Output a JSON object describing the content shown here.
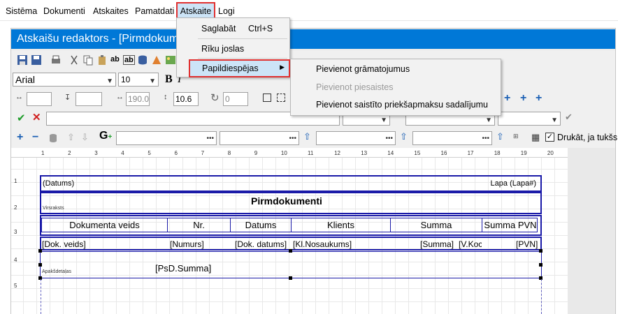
{
  "menubar": {
    "items": [
      "Sistēma",
      "Dokumenti",
      "Atskaites",
      "Pamatdati",
      "Atskaite",
      "Logi"
    ]
  },
  "window": {
    "title": "Atskaišu redaktors - [Pirmdokum"
  },
  "menu": {
    "items": [
      {
        "label": "Saglabāt",
        "shortcut": "Ctrl+S"
      },
      {
        "label": "Rīku joslas",
        "shortcut": ""
      },
      {
        "label": "Papildiespējas",
        "shortcut": ""
      }
    ]
  },
  "submenu": {
    "items": [
      {
        "label": "Pievienot grāmatojumus",
        "enabled": true
      },
      {
        "label": "Pievienot piesaistes",
        "enabled": false
      },
      {
        "label": "Pievienot saistīto priekšapmaksu sadalījumu",
        "enabled": true
      }
    ]
  },
  "toolbar": {
    "font_name": "Arial",
    "font_size": "10",
    "left_val": "190.0",
    "height_val": "10.6",
    "rotate_val": "0",
    "print_checkbox_label": "Drukāt, ja tukšs"
  },
  "ruler": {
    "ticks": [
      "1",
      "2",
      "3",
      "4",
      "5",
      "6",
      "7",
      "8",
      "9",
      "10",
      "11",
      "12",
      "13",
      "14",
      "15",
      "16",
      "17",
      "18",
      "19",
      "20"
    ],
    "rows": [
      "1",
      "2",
      "3",
      "4",
      "5"
    ]
  },
  "report": {
    "page_header": {
      "left": "(Datums)",
      "right": "Lapa (Lapa#)"
    },
    "title": "Pirmdokumenti",
    "virsraksts_label": "Virsraksts",
    "columns": [
      "Dokumenta veids",
      "Nr.",
      "Datums",
      "Klients",
      "Summa",
      "Summa PVN"
    ],
    "detail": [
      "[Dok. veids]",
      "[Numurs]",
      "[Dok. datums]",
      "[Kl.Nosaukums]",
      "[Summa]",
      "[V.Koc",
      "[PVN]"
    ],
    "apaksdetalas_label": "Apakšdetaļas",
    "footer_sum": "[PsD.Summa]"
  },
  "colors": {
    "accent": "#0078d7",
    "band_border": "#1a1aa8",
    "highlight_box": "#e03030"
  }
}
